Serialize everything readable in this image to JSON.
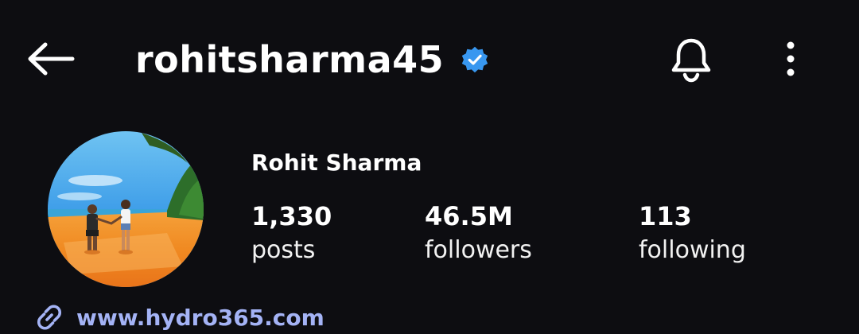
{
  "header": {
    "back_icon": "arrow-left-icon",
    "username": "rohitsharma45",
    "verified_icon": "verified-badge-icon",
    "bell_icon": "bell-icon",
    "more_icon": "more-vertical-icon"
  },
  "profile": {
    "display_name": "Rohit Sharma",
    "avatar_description_icon": "avatar-beach-photo",
    "stats": [
      {
        "count": "1,330",
        "label": "posts"
      },
      {
        "count": "46.5M",
        "label": "followers"
      },
      {
        "count": "113",
        "label": "following"
      }
    ],
    "link": {
      "icon": "link-icon",
      "text": "www.hydro365.com"
    }
  },
  "colors": {
    "background": "#0d0d11",
    "text": "#ffffff",
    "verified": "#3897f0",
    "link": "#a4b3f5"
  }
}
